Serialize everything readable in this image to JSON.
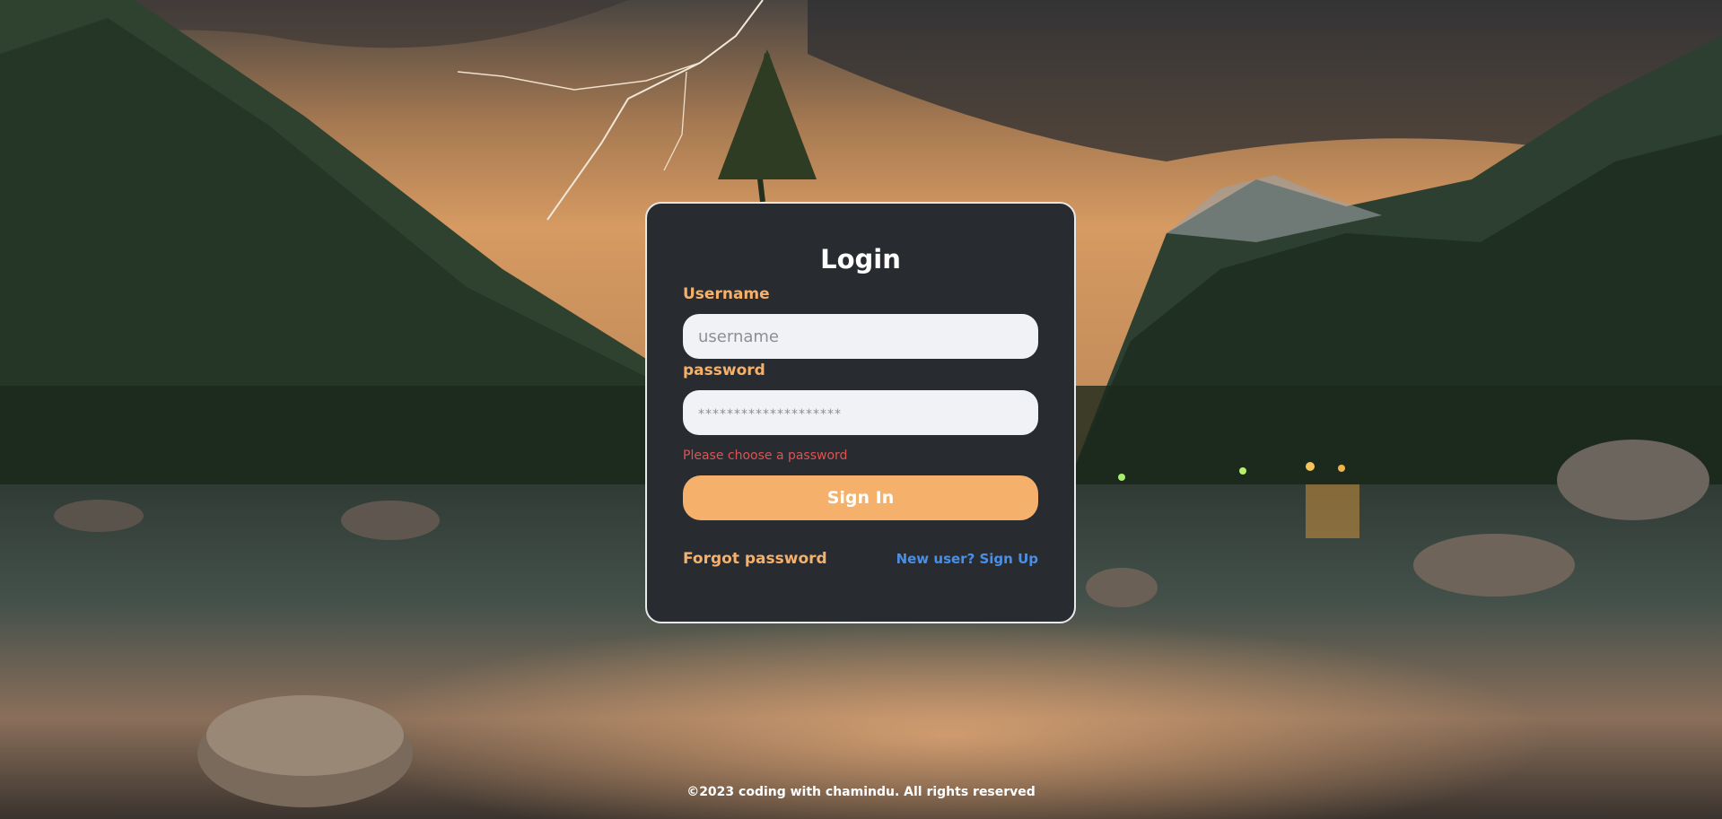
{
  "login": {
    "title": "Login",
    "username_label": "Username",
    "username_placeholder": "username",
    "password_label": "password",
    "password_placeholder": "********************",
    "password_error": "Please choose a password",
    "signin_label": "Sign In",
    "forgot_label": "Forgot password",
    "signup_label": "New user? Sign Up"
  },
  "footer": {
    "text": "©2023 coding with chamindu. All rights reserved"
  },
  "colors": {
    "accent": "#f5b06b",
    "card_bg": "#282c31",
    "link_blue": "#4a8fe7",
    "error": "#e05252"
  }
}
